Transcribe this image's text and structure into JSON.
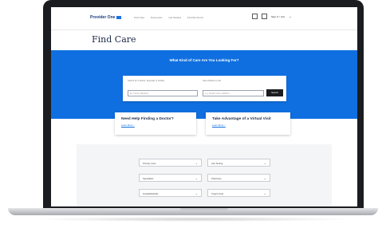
{
  "brand": {
    "logo_text": "Provider One"
  },
  "nav": [
    "Find Care",
    "Resources",
    "Get Started",
    "Find My Doctor"
  ],
  "account": {
    "label": "Sign In / Join",
    "caret": "⌄"
  },
  "page_title": "Find Care",
  "hero": {
    "heading": "What Kind of Care Are You Looking For?",
    "search": {
      "label_left": "Search for a Doctor, Specialty or Facility",
      "placeholder_left": "Ex: Family Medicine",
      "label_right": "Near Address or Zip",
      "placeholder_right": "e.g. Postal Code / Address",
      "button_label": "Search"
    }
  },
  "promos": [
    {
      "heading": "Need Help Finding a Doctor?",
      "link": "Learn More >"
    },
    {
      "heading": "Take Advantage of a Virtual Visit",
      "link": "Learn More >"
    }
  ],
  "filters": [
    {
      "label": "Primary Care"
    },
    {
      "label": "Lab Testing"
    },
    {
      "label": "Specialists"
    },
    {
      "label": "Pharmacy"
    },
    {
      "label": "Hospital/Facility"
    },
    {
      "label": "Urgent Care"
    }
  ],
  "colors": {
    "primary": "#0f6fe0",
    "navy": "#1c2a48",
    "button": "#1b1c1f"
  },
  "icons": [
    "grid-icon",
    "calendar-icon",
    "chevron-down-icon"
  ]
}
